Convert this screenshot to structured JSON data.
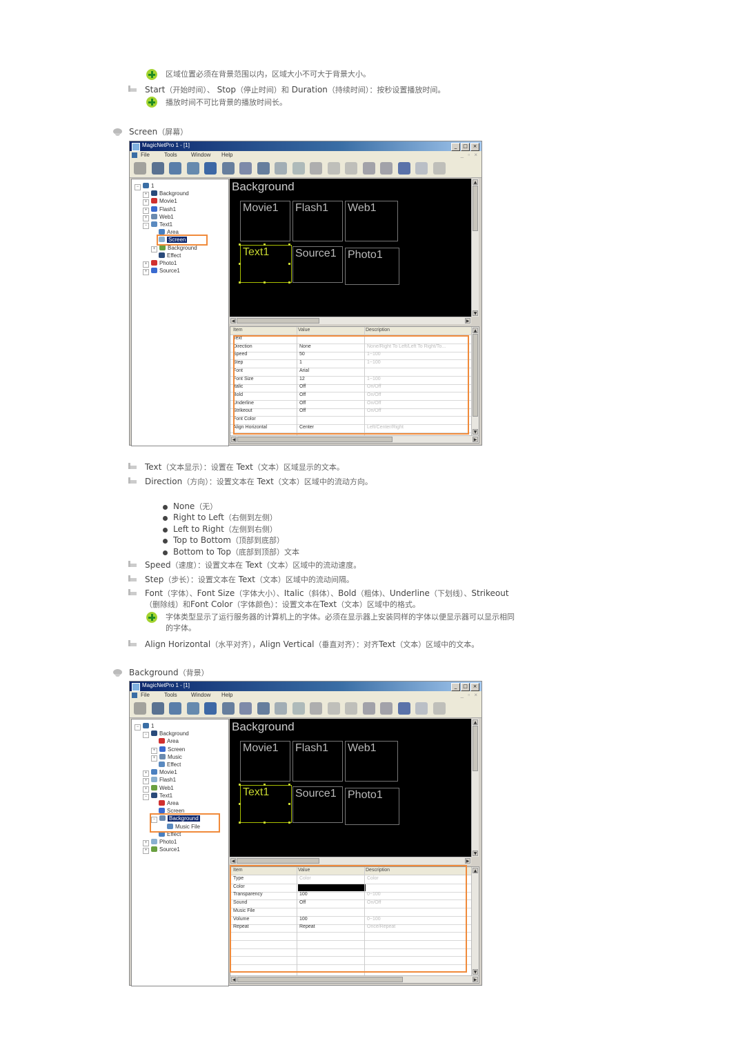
{
  "intro": {
    "tip1": "区域位置必须在背景范围以内，区域大小不可大于背景大小。",
    "item_start": {
      "lead": "Start",
      "zh1": "（开始时间）、",
      "lead2": "Stop",
      "zh2": "（停止时间）和",
      "lead3": "Duration",
      "zh3": "（持续时间）：按秒设置播放时间。"
    },
    "tip2": "播放时间不可比背景的播放时间长。"
  },
  "sections": [
    {
      "title": "Screen",
      "title_zh": "（屏幕）"
    },
    {
      "title": "Background",
      "title_zh": "（背景）"
    }
  ],
  "app": {
    "window_title": "MagicNetPro 1 - [1]",
    "window_buttons": [
      "_",
      "□",
      "×"
    ],
    "menu": [
      "File",
      "Tools",
      "Window",
      "Help"
    ],
    "mdi_buttons": "_ ▫ ×",
    "toolbar_icons": [
      "delete-icon",
      "monitor-icon",
      "flash-icon",
      "web-icon",
      "text-icon",
      "open-folder-icon",
      "save-icon",
      "photo-icon",
      "layout-icon",
      "layout2-icon",
      "edit-icon",
      "page-icon",
      "clock-icon",
      "text-format-icon",
      "text-format2-icon",
      "undo-icon",
      "redo-icon",
      "info-icon"
    ],
    "canvas": {
      "background_label": "Background",
      "boxes": [
        "Movie1",
        "Flash1",
        "Web1",
        "Text1",
        "Source1",
        "Photo1"
      ]
    },
    "grid_headers": [
      "Item",
      "Value",
      "Description"
    ]
  },
  "screen1": {
    "tree": [
      {
        "label": "1",
        "level": 0,
        "exp": "−"
      },
      {
        "label": "Background",
        "level": 1,
        "exp": "+"
      },
      {
        "label": "Movie1",
        "level": 1,
        "exp": "+"
      },
      {
        "label": "Flash1",
        "level": 1,
        "exp": "+"
      },
      {
        "label": "Web1",
        "level": 1,
        "exp": "+"
      },
      {
        "label": "Text1",
        "level": 1,
        "exp": "−"
      },
      {
        "label": "Area",
        "level": 2,
        "exp": ""
      },
      {
        "label": "Screen",
        "level": 2,
        "exp": "",
        "selected": true
      },
      {
        "label": "Background",
        "level": 2,
        "exp": "+"
      },
      {
        "label": "Effect",
        "level": 2,
        "exp": ""
      },
      {
        "label": "Photo1",
        "level": 1,
        "exp": "+"
      },
      {
        "label": "Source1",
        "level": 1,
        "exp": "+"
      }
    ],
    "rows": [
      {
        "item": "Text",
        "value": "",
        "desc": ""
      },
      {
        "item": "Direction",
        "value": "None",
        "desc": "None/Right To Left/Left To Right/To..."
      },
      {
        "item": "Speed",
        "value": "50",
        "desc": "1~100"
      },
      {
        "item": "Step",
        "value": "1",
        "desc": "1~100"
      },
      {
        "item": "Font",
        "value": "Arial",
        "desc": ""
      },
      {
        "item": "Font Size",
        "value": "12",
        "desc": "1~100"
      },
      {
        "item": "Italic",
        "value": "Off",
        "desc": "On/Off"
      },
      {
        "item": "Bold",
        "value": "Off",
        "desc": "On/Off"
      },
      {
        "item": "Underline",
        "value": "Off",
        "desc": "On/Off"
      },
      {
        "item": "Strikeout",
        "value": "Off",
        "desc": "On/Off"
      },
      {
        "item": "Font Color",
        "value": "",
        "desc": ""
      },
      {
        "item": "Align Horizontal",
        "value": "Center",
        "desc": "Left/Center/Right"
      }
    ]
  },
  "middle": {
    "item_text": {
      "lead": "Text",
      "zh1": "（文本显示）：设置在",
      "lead2": "Text",
      "zh2": "（文本）区域显示的文本。"
    },
    "item_direction": {
      "lead": "Direction",
      "zh1": "（方向）：设置文本在",
      "lead2": "Text",
      "zh2": "（文本）区域中的流动方向。"
    },
    "directions": [
      {
        "en": "None",
        "zh": "（无）"
      },
      {
        "en": "Right to Left",
        "zh": "（右侧到左侧）"
      },
      {
        "en": "Left to Right",
        "zh": "（左侧到右侧）"
      },
      {
        "en": "Top to Bottom",
        "zh": "（顶部到底部）"
      },
      {
        "en": "Bottom to Top",
        "zh": "（底部到顶部）文本"
      }
    ],
    "item_speed": {
      "lead": "Speed",
      "zh1": "（速度）：设置文本在",
      "lead2": "Text",
      "zh2": "（文本）区域中的流动速度。"
    },
    "item_step": {
      "lead": "Step",
      "zh1": "（步长）：设置文本在",
      "lead2": "Text",
      "zh2": "（文本）区域中的流动间隔。"
    },
    "item_font": {
      "l1": "Font",
      "z1": "（字体）、",
      "l2": "Font Size",
      "z2": "（字体大小）、",
      "l3": "Italic",
      "z3": "（斜体）、",
      "l4": "Bold",
      "z4": "（粗体)、",
      "l5": "Underline",
      "z5": "（下划线）、",
      "l6": "Strikeout",
      "z6": "（删除线）和",
      "l7": "Font Color",
      "z7": "（字体颜色）：设置文本在",
      "l8": "Text",
      "z8": "（文本）区域中的格式。"
    },
    "tip_font_1": "字体类型显示了运行服务器的计算机上的字体。必须在显示器上安装同样的字体以便显示器可以显示相同",
    "tip_font_2": "的字体。",
    "item_align": {
      "l1": "Align Horizontal",
      "z1": "（水平对齐），",
      "l2": "Align Vertical",
      "z2": "（垂直对齐）：对齐",
      "l3": "Text",
      "z3": "（文本）区域中的文本。"
    }
  },
  "screen2": {
    "tree": [
      {
        "label": "1",
        "level": 0,
        "exp": "−"
      },
      {
        "label": "Background",
        "level": 1,
        "exp": "−"
      },
      {
        "label": "Area",
        "level": 2,
        "exp": ""
      },
      {
        "label": "Screen",
        "level": 2,
        "exp": "+"
      },
      {
        "label": "Music",
        "level": 2,
        "exp": "+"
      },
      {
        "label": "Effect",
        "level": 2,
        "exp": ""
      },
      {
        "label": "Movie1",
        "level": 1,
        "exp": "+"
      },
      {
        "label": "Flash1",
        "level": 1,
        "exp": "+"
      },
      {
        "label": "Web1",
        "level": 1,
        "exp": "+"
      },
      {
        "label": "Text1",
        "level": 1,
        "exp": "−"
      },
      {
        "label": "Area",
        "level": 2,
        "exp": ""
      },
      {
        "label": "Screen",
        "level": 2,
        "exp": ""
      },
      {
        "label": "Background",
        "level": 2,
        "exp": "−",
        "selected": true
      },
      {
        "label": "Music File",
        "level": 3,
        "exp": ""
      },
      {
        "label": "Effect",
        "level": 2,
        "exp": ""
      },
      {
        "label": "Photo1",
        "level": 1,
        "exp": "+"
      },
      {
        "label": "Source1",
        "level": 1,
        "exp": "+"
      }
    ],
    "rows": [
      {
        "item": "Type",
        "value": "Color",
        "desc": "Color",
        "dim": true
      },
      {
        "item": "Color",
        "value": "",
        "desc": "",
        "swatch": "#000000"
      },
      {
        "item": "Transparency",
        "value": "100",
        "desc": "0~100"
      },
      {
        "item": "Sound",
        "value": "Off",
        "desc": "On/Off"
      },
      {
        "item": "Music File",
        "value": "",
        "desc": ""
      },
      {
        "item": "Volume",
        "value": "100",
        "desc": "0~100"
      },
      {
        "item": "Repeat",
        "value": "Repeat",
        "desc": "Once/Repeat"
      },
      {
        "item": "",
        "value": "",
        "desc": ""
      },
      {
        "item": "",
        "value": "",
        "desc": ""
      },
      {
        "item": "",
        "value": "",
        "desc": ""
      },
      {
        "item": "",
        "value": "",
        "desc": ""
      }
    ]
  },
  "colors": {
    "highlight": "#f08a3a",
    "tip_green": "#9fd12a",
    "selection": "#0a246a"
  }
}
